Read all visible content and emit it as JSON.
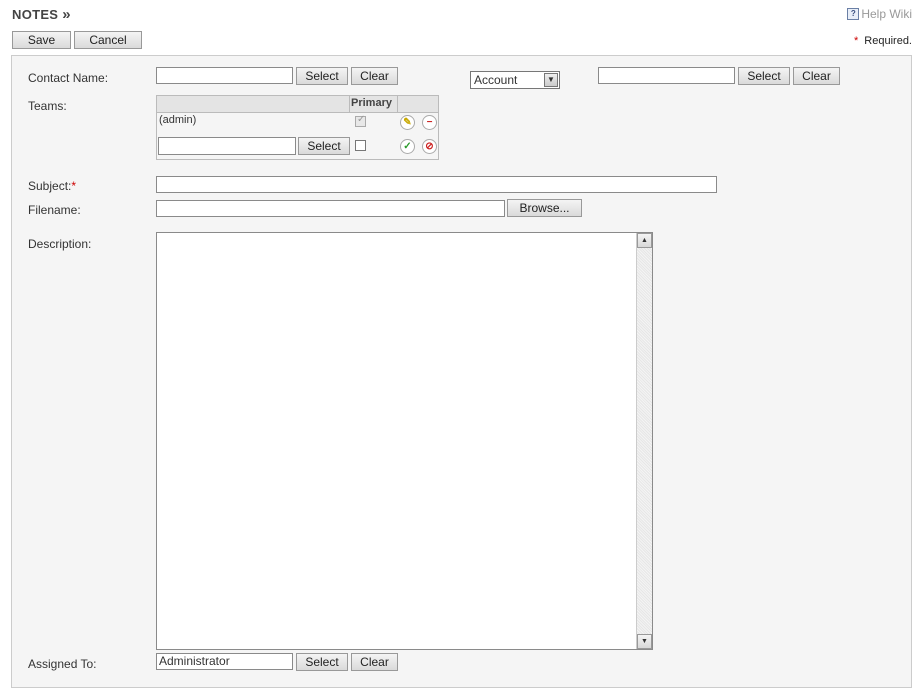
{
  "header": {
    "title": "NOTES",
    "title_chevron": "»",
    "help_label": "Help Wiki",
    "help_icon": "question-help-icon"
  },
  "toolbar": {
    "save_label": "Save",
    "cancel_label": "Cancel",
    "required_star": "*",
    "required_label": "Required."
  },
  "form": {
    "contact_name": {
      "label": "Contact Name:",
      "value": "",
      "select_label": "Select",
      "clear_label": "Clear"
    },
    "parent": {
      "type_value": "Account",
      "value": "",
      "select_label": "Select",
      "clear_label": "Clear"
    },
    "teams": {
      "label": "Teams:",
      "primary_header": "Primary",
      "rows": [
        {
          "name": "(admin)",
          "primary": true
        }
      ],
      "new_row": {
        "value": "",
        "select_label": "Select",
        "primary": false
      }
    },
    "subject": {
      "label": "Subject:",
      "required_star": "*",
      "value": ""
    },
    "filename": {
      "label": "Filename:",
      "value": "",
      "browse_label": "Browse..."
    },
    "description": {
      "label": "Description:",
      "value": ""
    },
    "assigned_to": {
      "label": "Assigned To:",
      "value": "Administrator",
      "select_label": "Select",
      "clear_label": "Clear"
    }
  },
  "colors": {
    "required": "#cc0000",
    "panel_bg": "#f5f5f5",
    "edit_icon": "#c8a800",
    "remove_icon": "#cc2222",
    "confirm_icon": "#2a9a2a",
    "cancel_icon": "#cc2222"
  }
}
